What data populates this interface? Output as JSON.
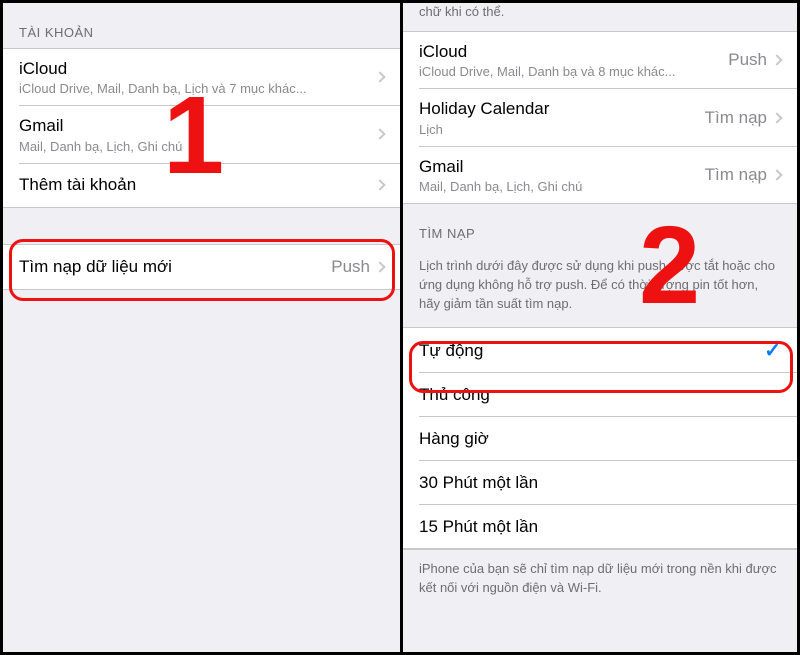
{
  "left": {
    "section_header": "TÀI KHOẢN",
    "accounts": [
      {
        "title": "iCloud",
        "sub": "iCloud Drive, Mail, Danh bạ, Lịch và 7 mục khác..."
      },
      {
        "title": "Gmail",
        "sub": "Mail, Danh bạ, Lịch, Ghi chú"
      },
      {
        "title": "Thêm tài khoản",
        "sub": ""
      }
    ],
    "fetch_row": {
      "title": "Tìm nạp dữ liệu mới",
      "value": "Push"
    },
    "overlay_number": "1"
  },
  "right": {
    "cut_top_text": "chữ khi có thể.",
    "accounts": [
      {
        "title": "iCloud",
        "sub": "iCloud Drive, Mail, Danh bạ và 8 mục khác...",
        "value": "Push"
      },
      {
        "title": "Holiday Calendar",
        "sub": "Lịch",
        "value": "Tìm nạp"
      },
      {
        "title": "Gmail",
        "sub": "Mail, Danh bạ, Lịch, Ghi chú",
        "value": "Tìm nạp"
      }
    ],
    "fetch_header": "TÌM NẠP",
    "fetch_desc": "Lịch trình dưới đây được sử dụng khi push được tắt hoặc cho ứng dụng không hỗ trợ push. Để có thời lượng pin tốt hơn, hãy giảm tần suất tìm nạp.",
    "fetch_options": [
      {
        "label": "Tự động",
        "selected": true
      },
      {
        "label": "Thủ công",
        "selected": false
      },
      {
        "label": "Hàng giờ",
        "selected": false
      },
      {
        "label": "30 Phút một lần",
        "selected": false
      },
      {
        "label": "15 Phút một lần",
        "selected": false
      }
    ],
    "footer_note": "iPhone của bạn sẽ chỉ tìm nạp dữ liệu mới trong nền khi được kết nối với nguồn điện và Wi-Fi.",
    "overlay_number": "2"
  }
}
